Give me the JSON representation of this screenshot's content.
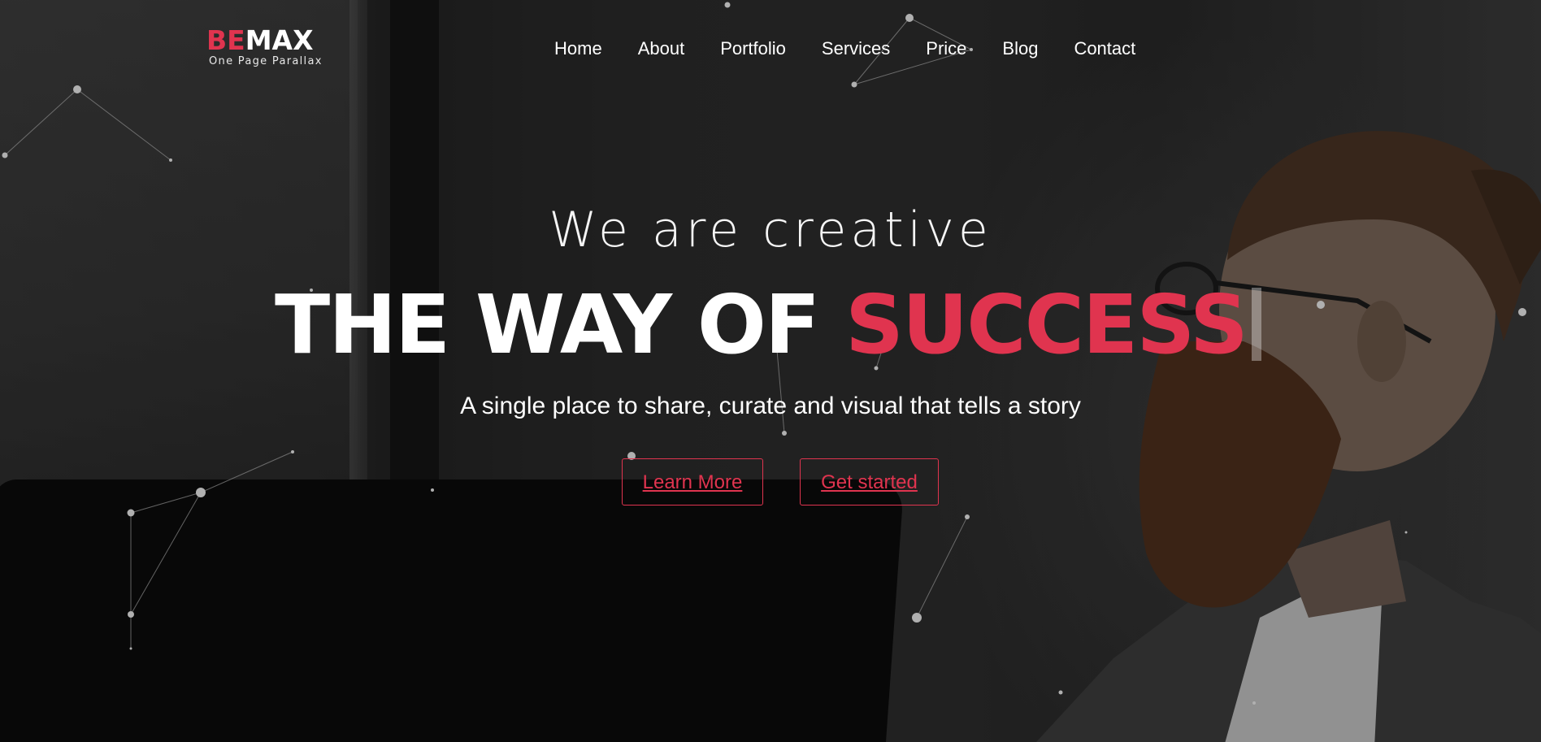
{
  "logo": {
    "accent_part": "BE",
    "main_part": "MAX",
    "tagline": "One Page Parallax"
  },
  "nav": {
    "items": [
      "Home",
      "About",
      "Portfolio",
      "Services",
      "Price",
      "Blog",
      "Contact"
    ]
  },
  "hero": {
    "kicker": "We are creative",
    "headline_main": "THE WAY OF ",
    "headline_accent": "SUCCESS",
    "subline": "A single place to share, curate and visual that tells a story",
    "buttons": {
      "learn_more": "Learn More",
      "get_started": "Get started"
    }
  },
  "colors": {
    "accent": "#e0344f",
    "text": "#ffffff",
    "background": "#262626"
  }
}
